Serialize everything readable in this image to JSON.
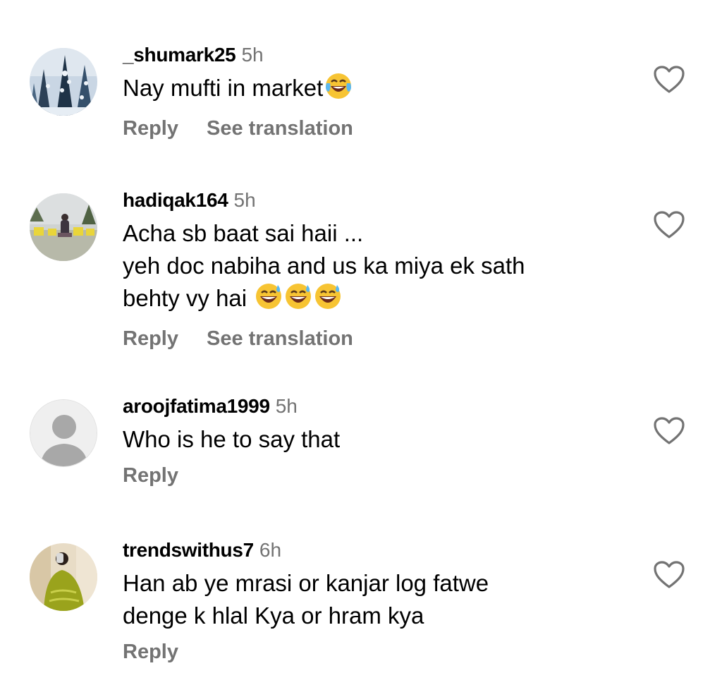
{
  "comments": [
    {
      "username": "_shumark25",
      "time": "5h",
      "lines": [
        "Nay mufti in market"
      ],
      "emoji": [
        "face-with-tears-of-joy"
      ],
      "actions": {
        "reply": "Reply",
        "translate": "See translation"
      }
    },
    {
      "username": "hadiqak164",
      "time": "5h",
      "lines": [
        "Acha sb baat sai haii ...",
        "yeh doc nabiha and us ka miya ek sath",
        "behty vy hai"
      ],
      "emoji": [
        "grinning-face-with-sweat",
        "grinning-face-with-sweat",
        "grinning-face-with-sweat"
      ],
      "actions": {
        "reply": "Reply",
        "translate": "See translation"
      }
    },
    {
      "username": "aroojfatima1999",
      "time": "5h",
      "lines": [
        "Who is he to say that"
      ],
      "actions": {
        "reply": "Reply"
      }
    },
    {
      "username": "trendswithus7",
      "time": "6h",
      "lines": [
        "Han ab ye mrasi or kanjar log fatwe",
        "denge k hlal Kya or hram kya"
      ],
      "actions": {
        "reply": "Reply"
      }
    }
  ],
  "icons": {
    "like": "heart-outline-icon",
    "default_avatar": "person-silhouette-icon"
  },
  "colors": {
    "text": "#000000",
    "secondary": "#737373",
    "avatar_placeholder_bg": "#efefef",
    "avatar_placeholder_fg": "#a8a8a8"
  }
}
